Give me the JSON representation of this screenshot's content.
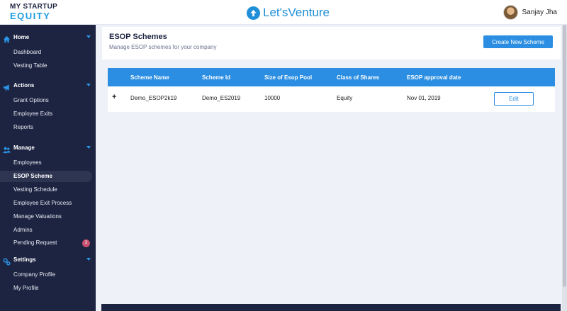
{
  "brand": {
    "line1": "MY STARTUP",
    "line2": "EQUITY"
  },
  "center_logo": {
    "text": "Let'sVenture",
    "icon": "upload-arrow-icon"
  },
  "user": {
    "name": "Sanjay Jha"
  },
  "sidebar": {
    "sections": [
      {
        "title": "Home",
        "icon": "home-icon",
        "items": [
          {
            "label": "Dashboard"
          },
          {
            "label": "Vesting Table"
          }
        ]
      },
      {
        "title": "Actions",
        "icon": "megaphone-icon",
        "items": [
          {
            "label": "Grant Options"
          },
          {
            "label": "Employee Exits"
          },
          {
            "label": "Reports"
          }
        ]
      },
      {
        "title": "Manage",
        "icon": "users-icon",
        "items": [
          {
            "label": "Employees"
          },
          {
            "label": "ESOP Scheme",
            "active": true
          },
          {
            "label": "Vesting Schedule"
          },
          {
            "label": "Employee Exit Process"
          },
          {
            "label": "Manage Valuations"
          },
          {
            "label": "Admins"
          },
          {
            "label": "Pending Request",
            "badge": "3"
          }
        ]
      },
      {
        "title": "Settings",
        "icon": "settings-icon",
        "items": [
          {
            "label": "Company Profile"
          },
          {
            "label": "My Profile"
          }
        ]
      }
    ]
  },
  "page": {
    "title": "ESOP Schemes",
    "subtitle": "Manage ESOP schemes for your company",
    "create_button": "Create New Scheme"
  },
  "table": {
    "columns": [
      "Scheme Name",
      "Scheme Id",
      "Size of Esop Pool",
      "Class of Shares",
      "ESOP approval date"
    ],
    "rows": [
      {
        "expand": "+",
        "cells": [
          "Demo_ESOP2k19",
          "Demo_ES2019",
          "10000",
          "Equity",
          "Nov 01, 2019"
        ],
        "action": "Edit"
      }
    ]
  },
  "colors": {
    "sidebar": "#1d2441",
    "accent": "#2b8ee2",
    "badge": "#c9506e",
    "background": "#eef1f8"
  }
}
